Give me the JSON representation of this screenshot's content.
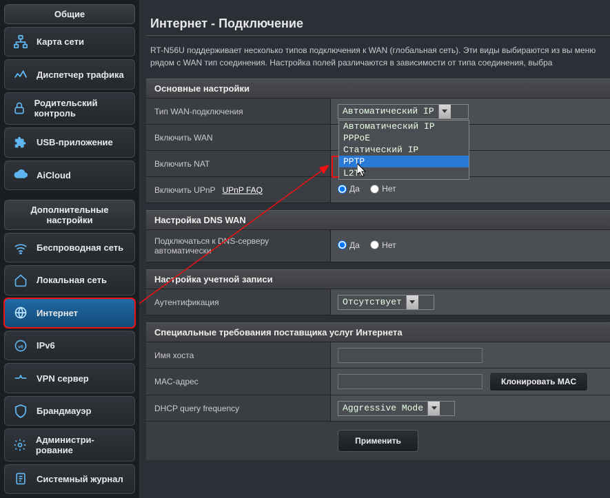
{
  "sidebar": {
    "section1_title": "Общие",
    "section2_title": "Дополнительные настройки",
    "items1": [
      {
        "label": "Карта сети"
      },
      {
        "label": "Диспетчер трафика"
      },
      {
        "label": "Родительский контроль"
      },
      {
        "label": "USB-приложение"
      },
      {
        "label": "AiCloud"
      }
    ],
    "items2": [
      {
        "label": "Беспроводная сеть"
      },
      {
        "label": "Локальная сеть"
      },
      {
        "label": "Интернет"
      },
      {
        "label": "IPv6"
      },
      {
        "label": "VPN сервер"
      },
      {
        "label": "Брандмауэр"
      },
      {
        "label": "Администри-рование"
      },
      {
        "label": "Системный журнал"
      }
    ]
  },
  "page": {
    "title": "Интернет - Подключение",
    "intro": "RT-N56U поддерживает несколько типов подключения к WAN (глобальная сеть). Эти виды выбираются из вы меню рядом с WAN тип соединения. Настройка полей различаются в зависимости от типа соединения, выбра"
  },
  "sections": {
    "basic": {
      "title": "Основные настройки",
      "wan_type_label": "Тип WAN-подключения",
      "wan_type_value": "Автоматический IP",
      "wan_type_options": [
        "Автоматический IP",
        "PPPoE",
        "Статический IP",
        "PPTP",
        "L2TP"
      ],
      "enable_wan_label": "Включить WAN",
      "enable_nat_label": "Включить NAT",
      "enable_upnp_label": "Включить UPnP",
      "upnp_link": "UPnP  FAQ"
    },
    "dns": {
      "title": "Настройка DNS WAN",
      "auto_dns_label": "Подключаться к DNS-серверу автоматически"
    },
    "account": {
      "title": "Настройка учетной записи",
      "auth_label": "Аутентификация",
      "auth_value": "Отсутствует"
    },
    "isp": {
      "title": "Специальные требования поставщика услуг Интернета",
      "hostname_label": "Имя хоста",
      "mac_label": "MAC-адрес",
      "clone_mac": "Клонировать MAC",
      "dhcp_label": "DHCP query frequency",
      "dhcp_value": "Aggressive Mode"
    }
  },
  "radio": {
    "yes": "Да",
    "no": "Нет"
  },
  "apply": "Применить"
}
